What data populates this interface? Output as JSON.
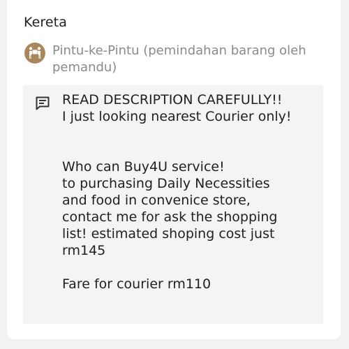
{
  "vehicle": "Kereta",
  "service": {
    "icon": "door-to-door-delivery-icon",
    "label": "Pintu-ke-Pintu (pemindahan barang oleh pemandu)"
  },
  "description": {
    "icon": "message-icon",
    "text": "READ DESCRIPTION CAREFULLY!!\nI just looking nearest Courier only!\n\n\nWho can Buy4U service!\nto purchasing Daily Necessities\nand food in convenice store,\ncontact me for ask the shopping\nlist! estimated shoping cost just\nrm145\n\nFare for courier rm110"
  },
  "colors": {
    "service_icon_bg": "#a9875b",
    "service_text": "#8a8a8a",
    "description_bg": "#f4f4f4"
  }
}
